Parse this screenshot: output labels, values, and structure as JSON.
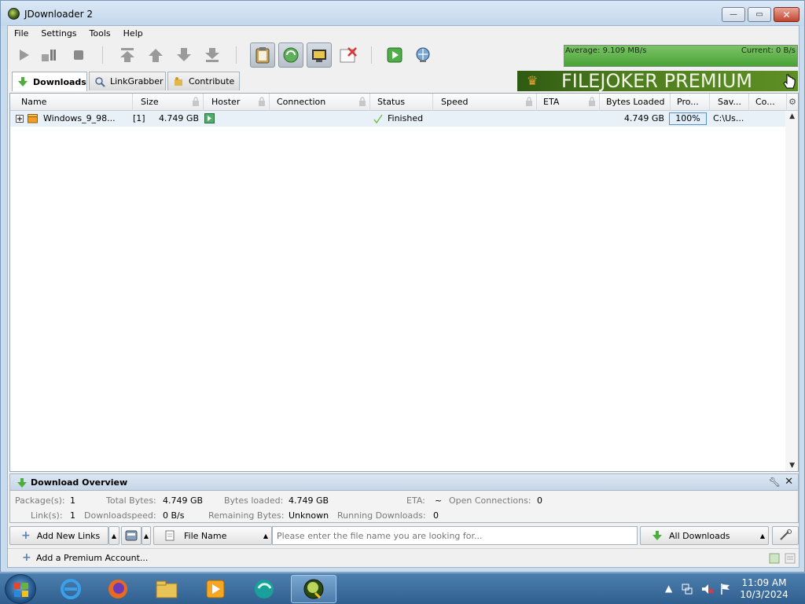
{
  "window": {
    "title": "JDownloader 2",
    "controls": {
      "minimize": "—",
      "maximize": "▭",
      "close": "✕"
    }
  },
  "menu": [
    "File",
    "Settings",
    "Tools",
    "Help"
  ],
  "toolbar": {
    "buttons": [
      "start-downloads",
      "pause",
      "stop",
      "move-top",
      "move-up",
      "move-down",
      "move-bottom",
      "clipboard-observer",
      "auto-reconnect",
      "premium-toggle",
      "remove-offline",
      "reconnect",
      "update"
    ],
    "speedmeter": {
      "average": "Average: 9.109 MB/s",
      "current": "Current: 0 B/s"
    }
  },
  "tabs": [
    {
      "label": "Downloads",
      "active": true
    },
    {
      "label": "LinkGrabber",
      "active": false
    },
    {
      "label": "Contribute",
      "active": false
    }
  ],
  "banner": {
    "text": "FILEJOKER PREMIUM"
  },
  "table": {
    "columns": [
      "Name",
      "Size",
      "Hoster",
      "Connection",
      "Status",
      "Speed",
      "ETA",
      "Bytes Loaded",
      "Pro...",
      "Sav...",
      "Co..."
    ],
    "rows": [
      {
        "expander": "+",
        "name": "Windows_9_98...",
        "count": "[1]",
        "size": "4.749 GB",
        "status": "Finished",
        "bytes_loaded": "4.749 GB",
        "progress": "100%",
        "save_to": "C:\\Us..."
      }
    ]
  },
  "overview": {
    "title": "Download Overview",
    "labels": {
      "packages": "Package(s):",
      "links": "Link(s):",
      "total_bytes": "Total Bytes:",
      "downloadspeed": "Downloadspeed:",
      "bytes_loaded": "Bytes loaded:",
      "remaining_bytes": "Remaining Bytes:",
      "eta": "ETA:",
      "running_downloads": "Running Downloads:",
      "open_connections": "Open Connections:"
    },
    "values": {
      "packages": "1",
      "links": "1",
      "total_bytes": "4.749 GB",
      "downloadspeed": "0 B/s",
      "bytes_loaded": "4.749 GB",
      "remaining_bytes": "Unknown",
      "eta": "~",
      "running_downloads": "0",
      "open_connections": "0"
    }
  },
  "bottombar": {
    "add_links": "Add New Links",
    "search_by": "File Name",
    "search_placeholder": "Please enter the file name you are looking for...",
    "filter": "All Downloads"
  },
  "statusbar": {
    "premium_link": "Add a Premium Account..."
  },
  "taskbar": {
    "apps": [
      "internet-explorer",
      "firefox",
      "file-explorer",
      "media-player",
      "browser-app",
      "jdownloader"
    ],
    "time": "11:09 AM",
    "date": "10/3/2024"
  },
  "colors": {
    "speed_green": "#49a334",
    "banner_green": "#4f7d1f",
    "selection_blue": "#e9f1f8"
  }
}
